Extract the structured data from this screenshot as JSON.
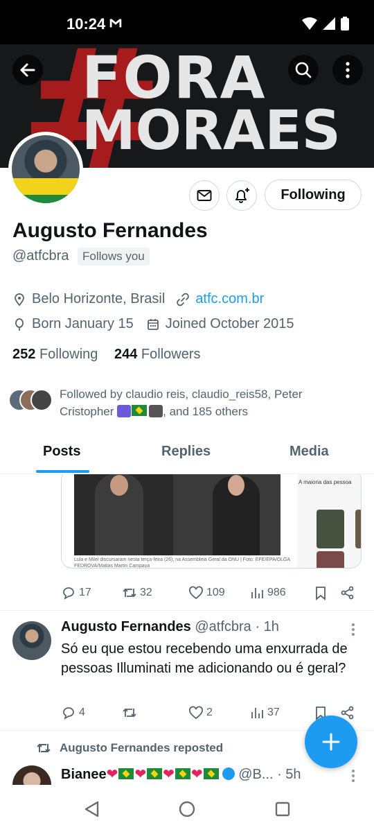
{
  "status_bar": {
    "time": "10:24"
  },
  "banner": {
    "hash": "#",
    "line1": "FORA",
    "line2": "MORAES"
  },
  "header": {
    "following_label": "Following"
  },
  "profile": {
    "name": "Augusto Fernandes",
    "handle": "@atfcbra",
    "follows_you": "Follows you",
    "location": "Belo Horizonte, Brasil",
    "website": "atfc.com.br",
    "born": "Born January 15",
    "joined": "Joined October 2015",
    "following_count": "252",
    "following_label": "Following",
    "followers_count": "244",
    "followers_label": "Followers",
    "followed_by_part1": "Followed by claudio reis, claudio_reis58, Peter Cristopher ",
    "followed_by_part2": ", and 185 others"
  },
  "tabs": [
    {
      "label": "Posts"
    },
    {
      "label": "Replies"
    },
    {
      "label": "Media"
    }
  ],
  "feed": {
    "post1": {
      "caption": "Lula e Milei discursaram nesta terça-feira (26), na Assembleia Geral da ONU | Foto: EFE/EPA/OLGA FEDROVA/Matias Martin Campaya",
      "shop_text": "A maioria das pessoa",
      "replies": "17",
      "reposts": "32",
      "likes": "109",
      "views": "986"
    },
    "post2": {
      "name": "Augusto Fernandes",
      "handle": "@atfcbra",
      "time": "· 1h",
      "text": "Só eu que estou recebendo uma enxurrada de pessoas Illuminati me adicionando ou é geral?",
      "replies": "4",
      "reposts": "",
      "likes": "2",
      "views": "37"
    },
    "repost": {
      "label": "Augusto Fernandes reposted",
      "name": "Bianee",
      "handle": "@B...",
      "time": "· 5h"
    }
  },
  "colors": {
    "accent": "#1d9bf0",
    "text": "#0f1419",
    "muted": "#536471"
  }
}
